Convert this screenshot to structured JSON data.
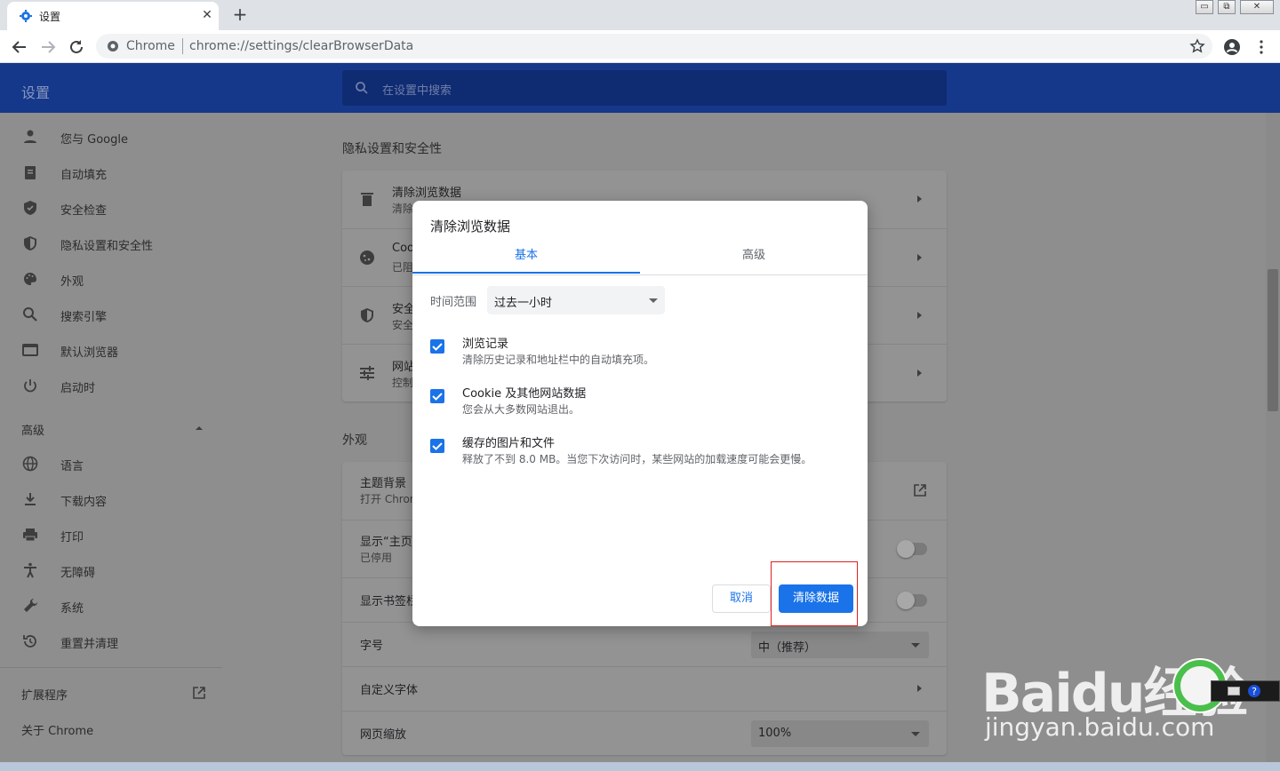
{
  "browser": {
    "tab_title": "设置",
    "tab_close": "✕",
    "new_tab": "+",
    "omnibox_brand": "Chrome",
    "url_scheme": "chrome://",
    "url_path": "settings/clearBrowserData",
    "window_controls": [
      "▭",
      "⧉",
      "✕"
    ]
  },
  "header": {
    "title": "设置",
    "search_placeholder": "在设置中搜索"
  },
  "sidebar": {
    "items": [
      {
        "label": "您与 Google",
        "icon": "person-icon"
      },
      {
        "label": "自动填充",
        "icon": "clipboard-icon"
      },
      {
        "label": "安全检查",
        "icon": "shield-check-icon"
      },
      {
        "label": "隐私设置和安全性",
        "icon": "shield-half-icon"
      },
      {
        "label": "外观",
        "icon": "palette-icon"
      },
      {
        "label": "搜索引擎",
        "icon": "search-icon"
      },
      {
        "label": "默认浏览器",
        "icon": "browser-icon"
      },
      {
        "label": "启动时",
        "icon": "power-icon"
      }
    ],
    "advanced_label": "高级",
    "advanced_items": [
      {
        "label": "语言",
        "icon": "globe-icon"
      },
      {
        "label": "下载内容",
        "icon": "download-icon"
      },
      {
        "label": "打印",
        "icon": "printer-icon"
      },
      {
        "label": "无障碍",
        "icon": "accessibility-icon"
      },
      {
        "label": "系统",
        "icon": "wrench-icon"
      },
      {
        "label": "重置并清理",
        "icon": "history-icon"
      }
    ],
    "extensions_label": "扩展程序",
    "about_label": "关于 Chrome"
  },
  "main": {
    "privacy_title": "隐私设置和安全性",
    "privacy_rows": [
      {
        "label": "清除浏览数据",
        "sub": "清除"
      },
      {
        "label": "Coo",
        "sub": "已阻"
      },
      {
        "label": "安全",
        "sub": "安全"
      },
      {
        "label": "网站",
        "sub": "控制"
      }
    ],
    "appearance_title": "外观",
    "appearance_rows": {
      "theme_label": "主题背景",
      "theme_sub": "打开 Chron",
      "home_label": "显示“主页”",
      "home_sub": "已停用",
      "bookmarks_label": "显示书签栏",
      "font_size_label": "字号",
      "font_size_value": "中（推荐）",
      "custom_font_label": "自定义字体",
      "zoom_label": "网页缩放",
      "zoom_value": "100%"
    }
  },
  "dialog": {
    "title": "清除浏览数据",
    "tab_basic": "基本",
    "tab_advanced": "高级",
    "time_range_label": "时间范围",
    "time_range_value": "过去一小时",
    "options": [
      {
        "title": "浏览记录",
        "sub": "清除历史记录和地址栏中的自动填充项。",
        "checked": true
      },
      {
        "title": "Cookie 及其他网站数据",
        "sub": "您会从大多数网站退出。",
        "checked": true
      },
      {
        "title": "缓存的图片和文件",
        "sub": "释放了不到 8.0 MB。当您下次访问时，某些网站的加载速度可能会更慢。",
        "checked": true
      }
    ],
    "cancel_label": "取消",
    "clear_label": "清除数据",
    "accent": "#1a73e8"
  },
  "watermark": {
    "main": "Baidu经验",
    "sub": "jingyan.baidu.com"
  }
}
